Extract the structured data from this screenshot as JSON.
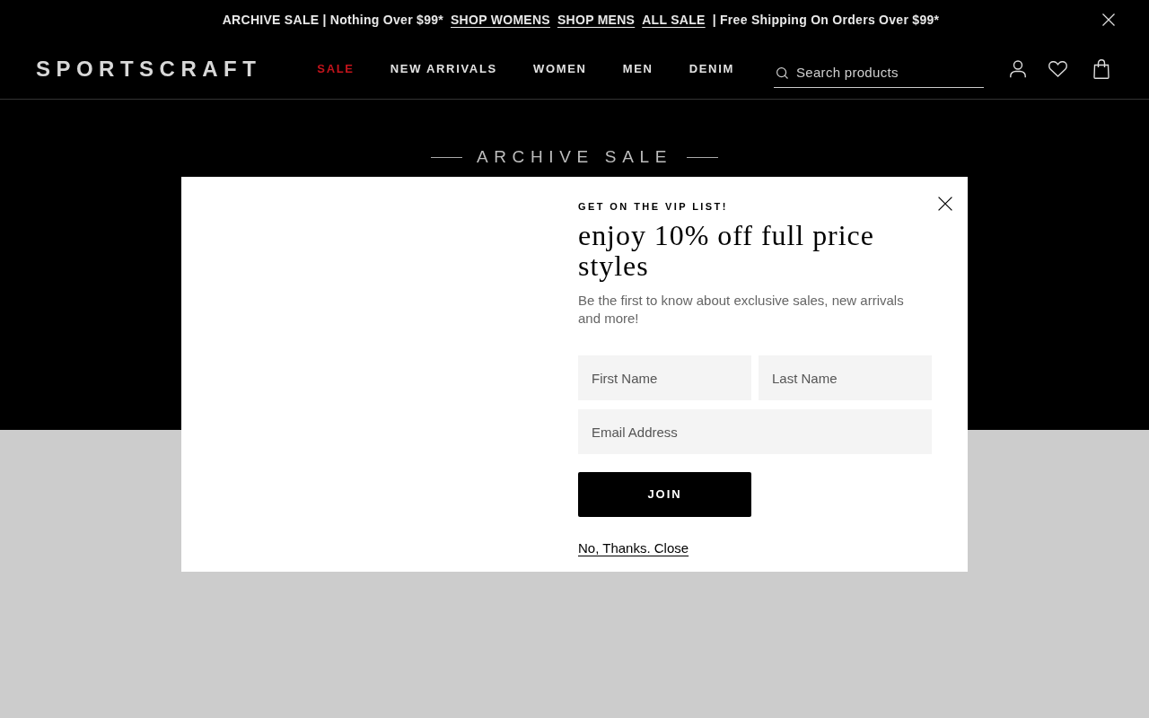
{
  "announcement": {
    "parts": [
      {
        "kind": "text",
        "text": "ARCHIVE SALE | Nothing Over $99*"
      },
      {
        "kind": "link",
        "text": "SHOP WOMENS"
      },
      {
        "kind": "link",
        "text": "SHOP MENS"
      },
      {
        "kind": "link",
        "text": "ALL SALE"
      },
      {
        "kind": "text",
        "text": "| Free Shipping On Orders Over $99*"
      }
    ]
  },
  "header": {
    "logo": "SPORTSCRAFT",
    "nav": [
      {
        "label": "SALE",
        "color": "#c4141c"
      },
      {
        "label": "NEW ARRIVALS",
        "color": "#e2e2e2"
      },
      {
        "label": "WOMEN",
        "color": "#e2e2e2"
      },
      {
        "label": "MEN",
        "color": "#e2e2e2"
      },
      {
        "label": "DENIM",
        "color": "#e2e2e2"
      }
    ],
    "search": {
      "placeholder": "Search products"
    }
  },
  "hero": {
    "title": "ARCHIVE SALE"
  },
  "signup_modal": {
    "eyebrow": "GET ON THE VIP LIST!",
    "heading": "enjoy 10% off full price styles",
    "text": "Be the first to know about exclusive sales, new arrivals and more!",
    "fields": [
      {
        "placeholder": "First Name"
      },
      {
        "placeholder": "Last Name"
      },
      {
        "placeholder": "Email Address"
      }
    ],
    "button": "JOIN",
    "dismiss_link": "No, Thanks. Close"
  }
}
